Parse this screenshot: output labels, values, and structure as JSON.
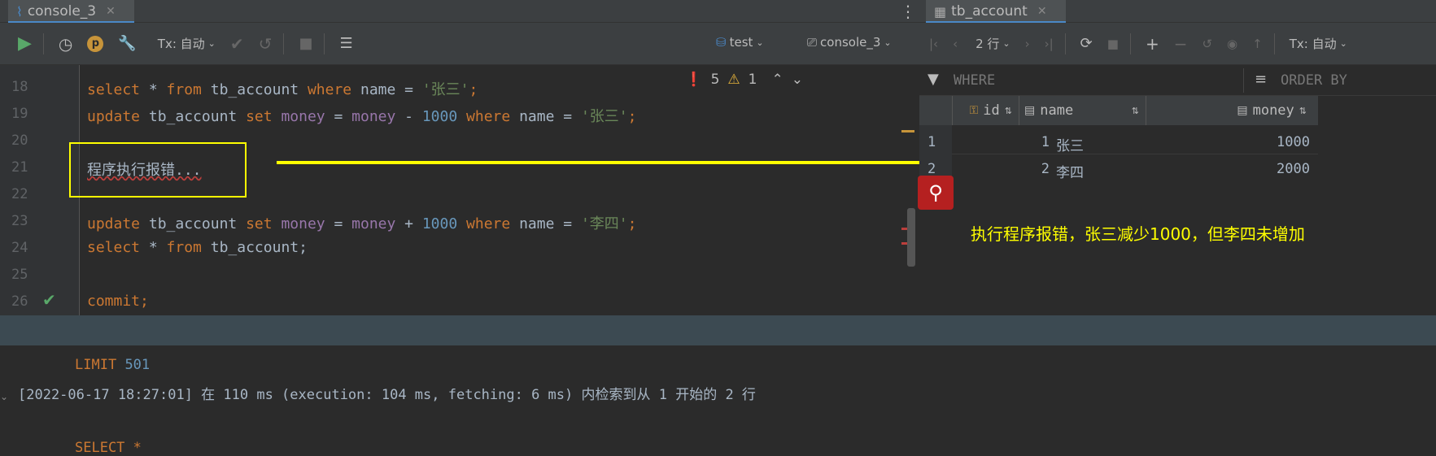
{
  "left_tab": {
    "label": "console_3",
    "close": "✕"
  },
  "right_tab": {
    "label": "tb_account",
    "close": "✕"
  },
  "toolbar": {
    "tx_label": "Tx: 自动",
    "schema": "test",
    "session": "console_3"
  },
  "status": {
    "errors": "5",
    "warnings": "1"
  },
  "lines": [
    {
      "n": "18"
    },
    {
      "n": "19"
    },
    {
      "n": "20"
    },
    {
      "n": "21"
    },
    {
      "n": "22"
    },
    {
      "n": "23"
    },
    {
      "n": "24"
    },
    {
      "n": "25"
    },
    {
      "n": "26"
    }
  ],
  "code": {
    "l18": [
      "select",
      " * ",
      "from",
      " tb_account ",
      "where",
      " name = ",
      "'张三'",
      ";"
    ],
    "l19": [
      "update",
      " tb_account ",
      "set",
      " ",
      "money",
      " = ",
      "money",
      " - ",
      "1000",
      " ",
      "where",
      " name = ",
      "'张三'",
      ";"
    ],
    "l21": "程序执行报错...",
    "l23": [
      "update",
      " tb_account ",
      "set",
      " ",
      "money",
      " = ",
      "money",
      " + ",
      "1000",
      " ",
      "where",
      " name = ",
      "'李四'",
      ";"
    ],
    "l24": [
      "select",
      " * ",
      "from",
      " tb_account;"
    ],
    "l26": "commit;"
  },
  "grid_toolbar": {
    "rows": "2 行",
    "tx_label": "Tx: 自动",
    "where": "WHERE",
    "order_by": "ORDER BY"
  },
  "grid": {
    "columns": [
      "id",
      "name",
      "money"
    ],
    "rows": [
      {
        "row": "1",
        "id": "1",
        "name": "张三",
        "money": "1000"
      },
      {
        "row": "2",
        "id": "2",
        "name": "李四",
        "money": "2000"
      }
    ]
  },
  "annotation": {
    "text": "执行程序报错，张三减少1000，但李四未增加",
    "color": "#ffff00"
  },
  "console": {
    "limit_kw": "LIMIT",
    "limit_val": "501",
    "log": "[2022-06-17 18:27:01] 在 110 ms (execution: 104 ms, fetching: 6 ms) 内检索到从 1 开始的 2 行",
    "next": "SELECT * "
  },
  "colors": {
    "keyword": "#cc7832",
    "column": "#9876aa",
    "number": "#6897bb",
    "string": "#6a8759",
    "highlight": "#ffff00"
  }
}
